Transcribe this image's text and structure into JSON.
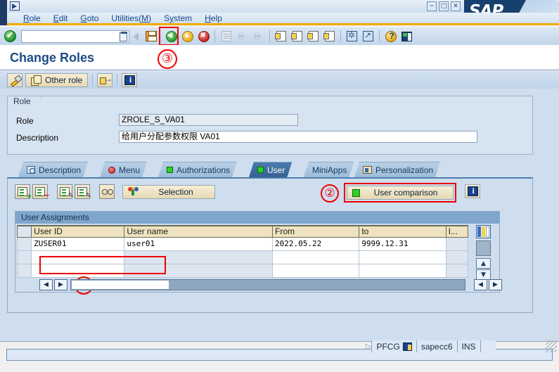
{
  "window": {
    "system_icon": "system-menu-icon",
    "minimize": "−",
    "maximize": "□",
    "close": "✕",
    "logo_text": "SAP"
  },
  "menubar": {
    "items": [
      {
        "label": "Role",
        "accel": "R"
      },
      {
        "label": "Edit",
        "accel": "E"
      },
      {
        "label": "Goto",
        "accel": "G"
      },
      {
        "label": "Utilities(M)",
        "accel": "M"
      },
      {
        "label": "System",
        "accel": "y"
      },
      {
        "label": "Help",
        "accel": "H"
      }
    ]
  },
  "toolbar": {
    "enter_button": "enter-checkmark",
    "command_field_value": "",
    "command_field_placeholder": "",
    "buttons": [
      {
        "name": "save",
        "label": "Save",
        "highlighted": true
      },
      {
        "name": "back",
        "label": "Back"
      },
      {
        "name": "exit",
        "label": "Exit"
      },
      {
        "name": "cancel",
        "label": "Cancel"
      },
      {
        "name": "print",
        "label": "Print"
      },
      {
        "name": "find",
        "label": "Find"
      },
      {
        "name": "find-next",
        "label": "Find Next"
      },
      {
        "name": "first-page",
        "label": "First Page"
      },
      {
        "name": "previous-page",
        "label": "Previous Page"
      },
      {
        "name": "next-page",
        "label": "Next Page"
      },
      {
        "name": "last-page",
        "label": "Last Page"
      },
      {
        "name": "create-session",
        "label": "Create New Session"
      },
      {
        "name": "create-shortcut",
        "label": "Create Shortcut"
      },
      {
        "name": "help",
        "label": "Help"
      },
      {
        "name": "layout-menu",
        "label": "Customize Local Layout"
      }
    ]
  },
  "page": {
    "title": "Change Roles"
  },
  "apptoolbar": {
    "buttons": [
      {
        "name": "change-display",
        "label": ""
      },
      {
        "name": "other-role",
        "label": "Other role"
      },
      {
        "name": "distribute",
        "label": ""
      },
      {
        "name": "info",
        "label": ""
      }
    ]
  },
  "role_group": {
    "legend": "Role",
    "fields": [
      {
        "label": "Role",
        "value": "ZROLE_S_VA01"
      },
      {
        "label": "Description",
        "value": "给用户分配参数权限 VA01"
      }
    ]
  },
  "tabs": [
    {
      "label": "Description",
      "icon": "magnifier-icon",
      "selected": false
    },
    {
      "label": "Menu",
      "icon": "red-dot-icon",
      "selected": false
    },
    {
      "label": "Authorizations",
      "icon": "green-square-icon",
      "selected": false
    },
    {
      "label": "User",
      "icon": "green-square-icon",
      "selected": true
    },
    {
      "label": "MiniApps",
      "icon": "",
      "selected": false
    },
    {
      "label": "Personalization",
      "icon": "personalization-icon",
      "selected": false
    }
  ],
  "user_tab": {
    "toolbar_buttons": [
      {
        "name": "insert-row",
        "label": ""
      },
      {
        "name": "delete-row",
        "label": ""
      },
      {
        "name": "change-row",
        "label": ""
      },
      {
        "name": "copy-row",
        "label": ""
      },
      {
        "name": "display-selection",
        "label": ""
      },
      {
        "name": "selection",
        "label": "Selection"
      }
    ],
    "user_comparison_label": "User comparison",
    "info_button": "info-icon",
    "group_title": "User Assignments",
    "table": {
      "columns": [
        "User ID",
        "User name",
        "From",
        "to",
        "I..."
      ],
      "rows": [
        {
          "user_id": "ZUSER01",
          "user_name": "user01",
          "from": "2022.05.22",
          "to": "9999.12.31",
          "i": ""
        },
        {
          "user_id": "",
          "user_name": "",
          "from": "",
          "to": "",
          "i": ""
        },
        {
          "user_id": "",
          "user_name": "",
          "from": "",
          "to": "",
          "i": ""
        }
      ]
    },
    "scroll": {
      "column_config": "column-config-icon",
      "up": "▲",
      "down": "▼",
      "left": "◀",
      "right": "▶"
    }
  },
  "annotations": [
    {
      "id": "1",
      "label": "①",
      "target": "user-assignment-row"
    },
    {
      "id": "2",
      "label": "②",
      "target": "user-comparison-button"
    },
    {
      "id": "3",
      "label": "③",
      "target": "save-button"
    }
  ],
  "statusbar": {
    "message": "",
    "transaction": "PFCG",
    "session_icon": "session-icon",
    "system": "sapecc6",
    "insert_mode": "INS",
    "expand_indicator": "▷"
  },
  "colors": {
    "accent_orange": "#f0ab00",
    "sap_blue": "#17406e",
    "annotation_red": "#ee0000",
    "selected_tab": "#3b6ea5",
    "header_beige": "#efe3bf"
  }
}
